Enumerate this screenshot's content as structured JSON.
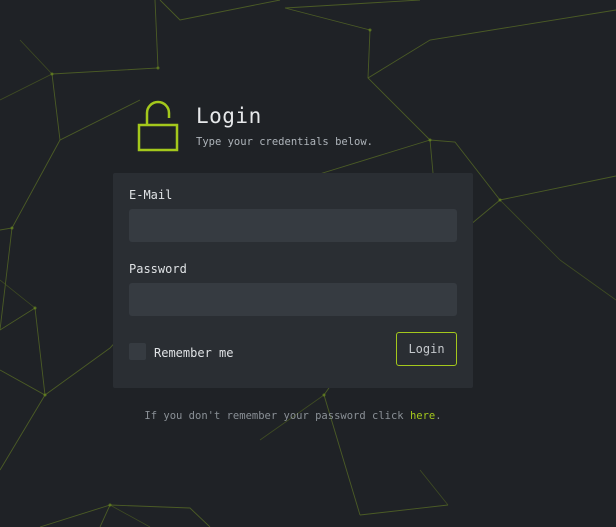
{
  "header": {
    "title": "Login",
    "subtitle": "Type your credentials below.",
    "icon": "unlocked-padlock-icon"
  },
  "form": {
    "email_label": "E-Mail",
    "email_value": "",
    "password_label": "Password",
    "password_value": "",
    "remember_label": "Remember me",
    "remember_checked": false,
    "login_label": "Login"
  },
  "footer": {
    "forgot_text": "If you don't remember your password click ",
    "forgot_link": "here",
    "forgot_suffix": "."
  },
  "colors": {
    "background": "#1f2226",
    "card": "#2a2e33",
    "input": "#363b41",
    "accent": "#a4c81c",
    "network_lines": "#4a5a22"
  }
}
